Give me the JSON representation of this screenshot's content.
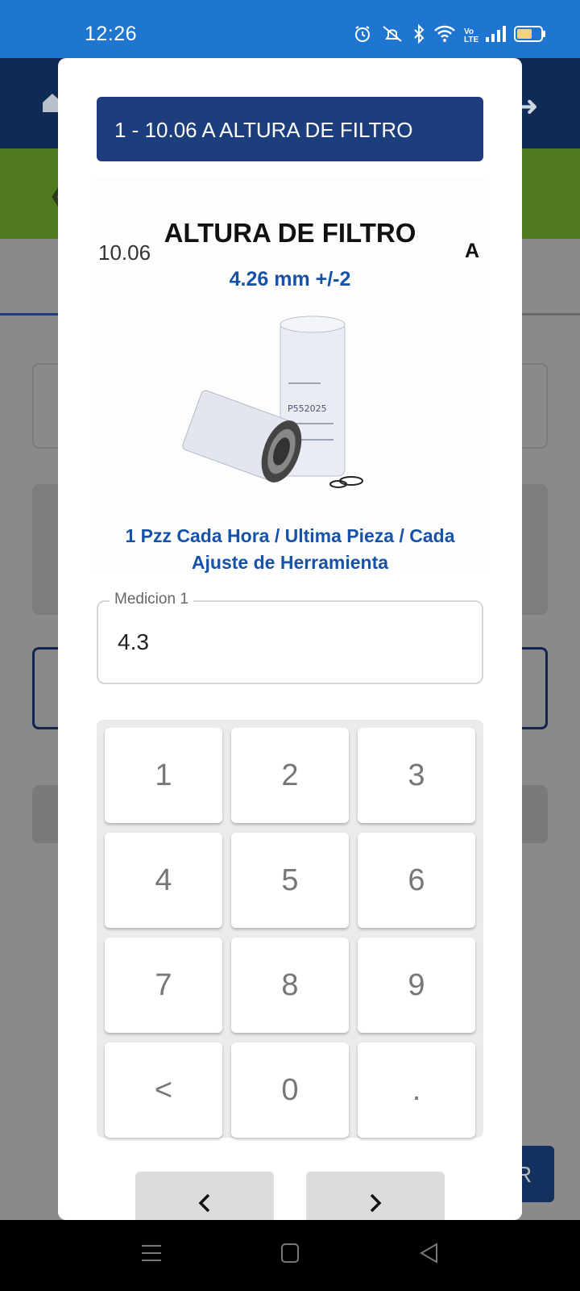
{
  "status_bar": {
    "time": "12:26",
    "icons": [
      "alarm-icon",
      "mute-icon",
      "bluetooth-icon",
      "wifi-icon",
      "volte-icon",
      "signal-icon",
      "battery-icon"
    ],
    "volte_label": "Vo LTE"
  },
  "background": {
    "header_color": "#0f2a55",
    "accent_green": "#4e7a1f",
    "button_letter": "R"
  },
  "modal": {
    "title": "1 - 10.06 A  ALTURA DE FILTRO",
    "characteristic": {
      "code": "10.06",
      "name": "ALTURA DE FILTRO",
      "grade": "A",
      "spec": "4.26 mm +/-2",
      "image_label": "P552025",
      "frequency": "1 Pzz Cada Hora / Ultima Pieza / Cada Ajuste de Herramienta"
    },
    "measurement": {
      "label": "Medicion 1",
      "value": "4.3"
    },
    "keypad": [
      "1",
      "2",
      "3",
      "4",
      "5",
      "6",
      "7",
      "8",
      "9",
      "<",
      "0",
      "."
    ],
    "prev_icon": "chevron-left-icon",
    "next_icon": "chevron-right-icon"
  },
  "colors": {
    "primary": "#1c3e7d",
    "link_blue": "#1652a8",
    "status_bar": "#1f76d1"
  }
}
